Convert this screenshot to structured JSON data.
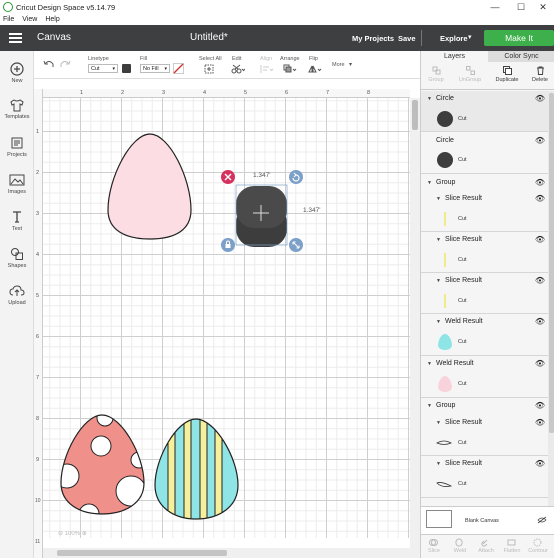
{
  "window": {
    "title": "Cricut Design Space  v5.14.79",
    "controls": {
      "minimize": "—",
      "maximize": "☐",
      "close": "✕"
    }
  },
  "menubar": [
    "File",
    "View",
    "Help"
  ],
  "header": {
    "section": "Canvas",
    "doc_title": "Untitled*",
    "my_projects": "My Projects",
    "save": "Save",
    "explore": "Explore",
    "make_it": "Make It",
    "accent": "#3eb04b"
  },
  "toolbar": {
    "linetype_label": "Linetype",
    "linetype_value": "Cut",
    "fill_label": "Fill",
    "fill_value": "No Fill",
    "select_all": "Select All",
    "edit": "Edit",
    "align": "Align",
    "arrange": "Arrange",
    "flip": "Flip",
    "more": "More"
  },
  "leftbar": [
    {
      "label": "New",
      "icon": "plus-circle-icon"
    },
    {
      "label": "Templates",
      "icon": "shirt-icon"
    },
    {
      "label": "Projects",
      "icon": "projects-icon"
    },
    {
      "label": "Images",
      "icon": "image-icon"
    },
    {
      "label": "Text",
      "icon": "text-icon"
    },
    {
      "label": "Shapes",
      "icon": "shapes-icon"
    },
    {
      "label": "Upload",
      "icon": "upload-icon"
    }
  ],
  "rulers": {
    "top": [
      "0",
      "1",
      "2",
      "3",
      "4",
      "5",
      "6",
      "7",
      "8"
    ],
    "left": [
      "1",
      "2",
      "3",
      "4",
      "5",
      "6",
      "7",
      "8",
      "9",
      "10",
      "11"
    ]
  },
  "selection": {
    "width": "1.347'",
    "height": "1.347'"
  },
  "zoom": "100%",
  "panel": {
    "tabs": [
      "Layers",
      "Color Sync"
    ],
    "actions": [
      "Group",
      "UnGroup",
      "Duplicate",
      "Delete"
    ],
    "layers": [
      {
        "name": "Circle",
        "op": "Cut",
        "kind": "circle",
        "color": "#3d3d3d"
      },
      {
        "name": "Circle",
        "op": "Cut",
        "kind": "circle",
        "color": "#3d3d3d"
      },
      {
        "name": "Group",
        "children": [
          {
            "name": "Slice Result",
            "op": "Cut",
            "kind": "line",
            "color": "#f2e98a"
          },
          {
            "name": "Slice Result",
            "op": "Cut",
            "kind": "line",
            "color": "#f2e98a"
          },
          {
            "name": "Slice Result",
            "op": "Cut",
            "kind": "line",
            "color": "#f2e98a"
          },
          {
            "name": "Weld Result",
            "op": "Cut",
            "kind": "egg",
            "color": "#8fe5e5"
          }
        ]
      },
      {
        "name": "Weld Result",
        "op": "Cut",
        "kind": "egg",
        "color": "#f9d3dc"
      },
      {
        "name": "Group",
        "children": [
          {
            "name": "Slice Result",
            "op": "Cut",
            "kind": "outline"
          },
          {
            "name": "Slice Result",
            "op": "Cut",
            "kind": "outline"
          }
        ]
      }
    ],
    "blank_canvas": "Blank Canvas",
    "bottom_actions": [
      "Slice",
      "Weld",
      "Attach",
      "Flatten",
      "Contour"
    ]
  }
}
